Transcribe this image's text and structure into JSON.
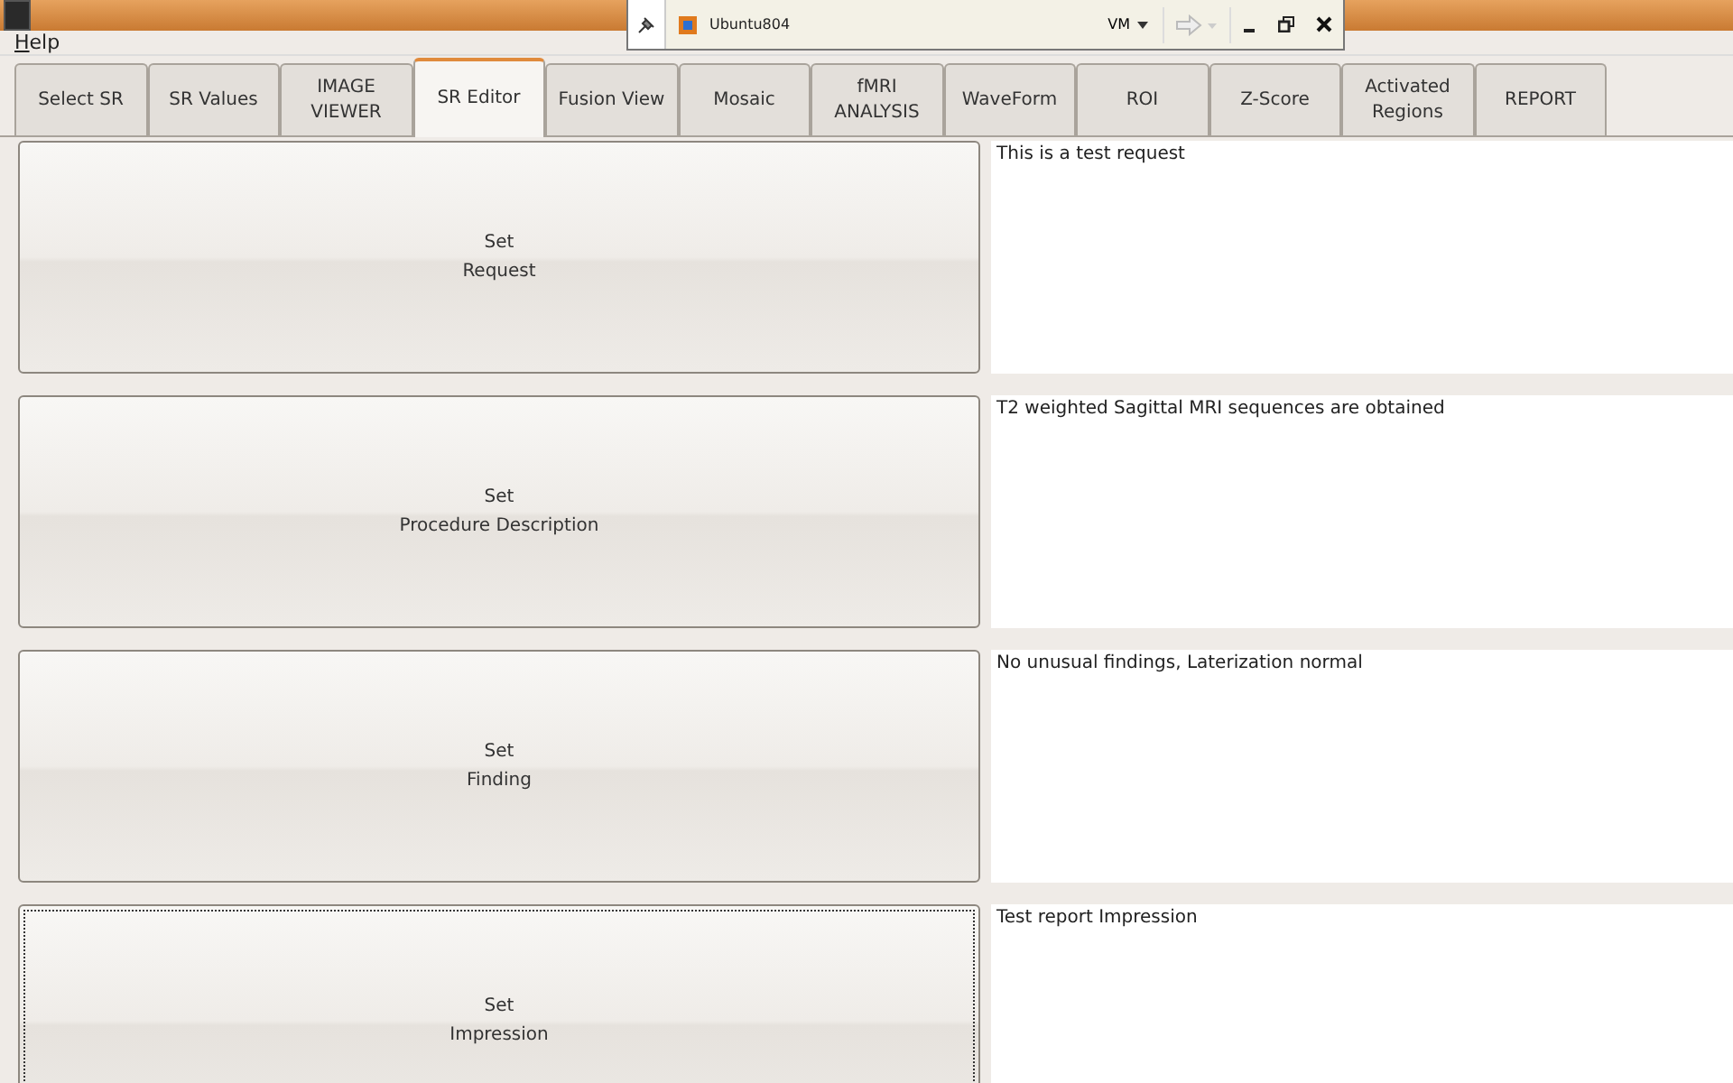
{
  "vm_toolbar": {
    "host": "Ubuntu804",
    "menu": "VM"
  },
  "menu": [
    {
      "mnemonic": "H",
      "rest": "elp"
    }
  ],
  "tabs": [
    {
      "label": "Select SR",
      "selected": false
    },
    {
      "label": "SR Values",
      "selected": false
    },
    {
      "label": "IMAGE\nVIEWER",
      "selected": false
    },
    {
      "label": "SR Editor",
      "selected": true
    },
    {
      "label": "Fusion View",
      "selected": false
    },
    {
      "label": "Mosaic",
      "selected": false
    },
    {
      "label": "fMRI\nANALYSIS",
      "selected": false
    },
    {
      "label": "WaveForm",
      "selected": false
    },
    {
      "label": "ROI",
      "selected": false
    },
    {
      "label": "Z-Score",
      "selected": false
    },
    {
      "label": "Activated\nRegions",
      "selected": false
    },
    {
      "label": "REPORT",
      "selected": false
    }
  ],
  "sections": [
    {
      "button": "Set\nRequest",
      "focused": false,
      "text": "This is a test request"
    },
    {
      "button": "Set\nProcedure Description",
      "focused": false,
      "text": "T2 weighted Sagittal MRI sequences are obtained"
    },
    {
      "button": "Set\nFinding",
      "focused": false,
      "text": "No unusual findings, Laterization normal"
    },
    {
      "button": "Set\nImpression",
      "focused": true,
      "text": "Test report Impression"
    }
  ]
}
